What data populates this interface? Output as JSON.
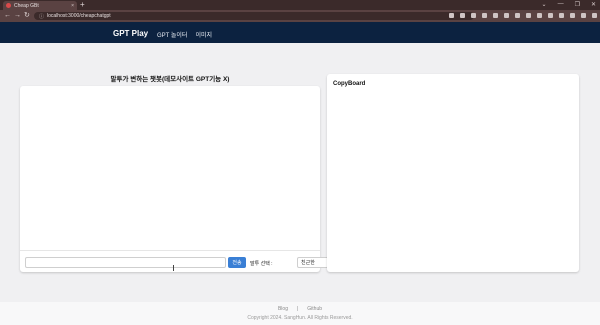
{
  "browser": {
    "tab_title": "Cheap GBt",
    "tab_close": "×",
    "new_tab": "+",
    "url": "localhost:3000/cheapchatgpt",
    "window_controls": [
      "⌄",
      "—",
      "❐",
      "✕"
    ]
  },
  "app": {
    "brand": "GPT Play",
    "nav": [
      "GPT 놀이터",
      "이미지"
    ]
  },
  "chat": {
    "title": "말투가 변하는 챗봇(데모사이트 GPT기능 X)",
    "input_value": "",
    "send_label": "전송",
    "tone_label": "말투 선택 :",
    "tone_selected": "친근한"
  },
  "copyboard": {
    "title": "CopyBoard"
  },
  "footer": {
    "link_blog": "Blog",
    "separator": "|",
    "link_github": "Github",
    "copyright": "Copyright 2024. SangHun. All Rights Reserved."
  },
  "colors": {
    "nav_bg": "#0c2240",
    "accent": "#3a7fd5",
    "page_bg": "#f0f0f2"
  }
}
